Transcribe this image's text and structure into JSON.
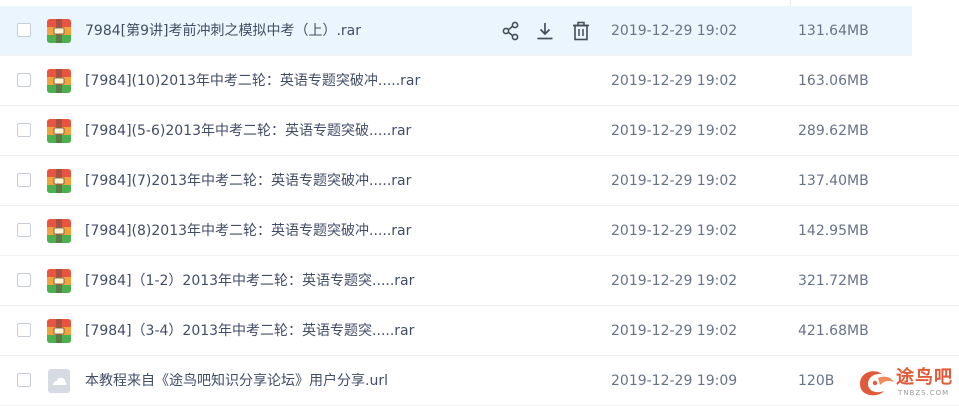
{
  "files": [
    {
      "name": "7984[第9讲]考前冲刺之模拟中考（上）.rar",
      "date": "2019-12-29 19:02",
      "size": "131.64MB",
      "type": "rar",
      "selected": true
    },
    {
      "name": "[7984](10)2013年中考二轮：英语专题突破冲.....rar",
      "date": "2019-12-29 19:02",
      "size": "163.06MB",
      "type": "rar"
    },
    {
      "name": "[7984](5-6)2013年中考二轮：英语专题突破.....rar",
      "date": "2019-12-29 19:02",
      "size": "289.62MB",
      "type": "rar"
    },
    {
      "name": "[7984](7)2013年中考二轮：英语专题突破冲.....rar",
      "date": "2019-12-29 19:02",
      "size": "137.40MB",
      "type": "rar"
    },
    {
      "name": "[7984](8)2013年中考二轮：英语专题突破冲.....rar",
      "date": "2019-12-29 19:02",
      "size": "142.95MB",
      "type": "rar"
    },
    {
      "name": "[7984]（1-2）2013年中考二轮：英语专题突.....rar",
      "date": "2019-12-29 19:02",
      "size": "321.72MB",
      "type": "rar"
    },
    {
      "name": "[7984]（3-4）2013年中考二轮：英语专题突.....rar",
      "date": "2019-12-29 19:02",
      "size": "421.68MB",
      "type": "rar"
    },
    {
      "name": "本教程来自《途鸟吧知识分享论坛》用户分享.url",
      "date": "2019-12-29 19:09",
      "size": "120B",
      "type": "url"
    }
  ],
  "row_actions": [
    {
      "name": "share-icon"
    },
    {
      "name": "download-icon"
    },
    {
      "name": "delete-icon"
    }
  ],
  "watermark": {
    "text": "途鸟吧",
    "sub": "TNBZS.COM",
    "color": "#e05b3a"
  },
  "colors": {
    "selected_row": "#ebf5fd",
    "accent": "#06a7ff",
    "text": "#424e67",
    "muted": "#687388"
  }
}
